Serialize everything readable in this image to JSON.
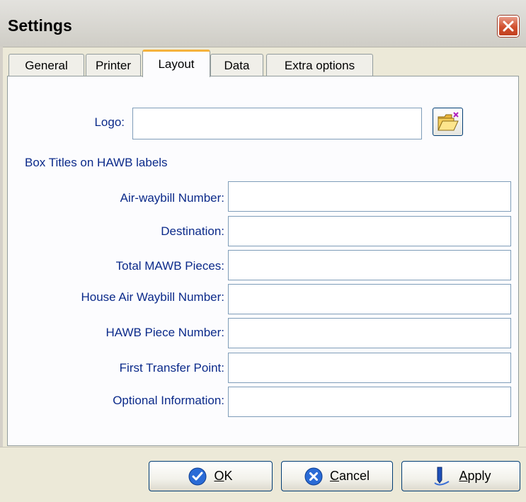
{
  "window": {
    "title": "Settings"
  },
  "tabs": [
    {
      "label": "General",
      "active": false
    },
    {
      "label": "Printer",
      "active": false
    },
    {
      "label": "Layout",
      "active": true
    },
    {
      "label": "Data",
      "active": false
    },
    {
      "label": "Extra options",
      "active": false
    }
  ],
  "logo": {
    "label": "Logo:",
    "value": ""
  },
  "section_heading": "Box Titles on HAWB labels",
  "fields": [
    {
      "label": "Air-waybill Number:",
      "value": ""
    },
    {
      "label": "Destination:",
      "value": ""
    },
    {
      "label": "Total MAWB Pieces:",
      "value": ""
    },
    {
      "label": "House Air Waybill Number:",
      "value": ""
    },
    {
      "label": "HAWB Piece Number:",
      "value": ""
    },
    {
      "label": "First Transfer Point:",
      "value": ""
    },
    {
      "label": "Optional Information:",
      "value": ""
    }
  ],
  "buttons": {
    "ok": {
      "mnemonic": "O",
      "rest": "K"
    },
    "cancel": {
      "mnemonic": "C",
      "rest": "ancel"
    },
    "apply": {
      "mnemonic": "A",
      "rest": "pply"
    }
  },
  "icons": {
    "close": "close-icon",
    "browse": "folder-open-icon",
    "ok": "checkmark-icon",
    "cancel": "x-icon",
    "apply": "pen-icon"
  },
  "colors": {
    "label_text": "#0b2a8a",
    "active_tab_accent": "#f5b23c",
    "close_button": "#d1502e",
    "field_border": "#7f9db9"
  }
}
